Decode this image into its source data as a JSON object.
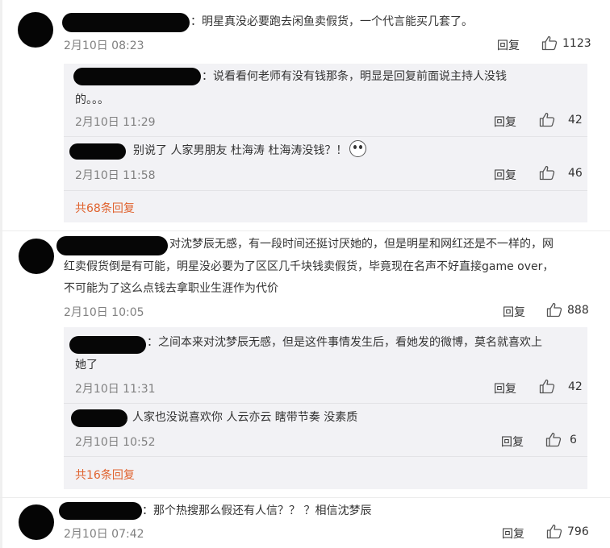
{
  "comments": [
    {
      "text": "：明星真没必要跑去闲鱼卖假货，一个代言能买几套了。",
      "time": "2月10日 08:23",
      "reply_label": "回复",
      "likes": "1123",
      "sub_replies": [
        {
          "text_line1": "：说看看何老师有没有钱那条，明显是回复前面说主持人没钱",
          "text_line2": "的。。。",
          "time": "2月10日 11:29",
          "reply_label": "回复",
          "likes": "42"
        },
        {
          "text_line1": "别说了 人家男朋友 杜海涛 杜海涛没钱？！",
          "time": "2月10日 11:58",
          "reply_label": "回复",
          "likes": "46"
        }
      ],
      "more": "共68条回复"
    },
    {
      "text_line1": "对沈梦辰无感，有一段时间还挺讨厌她的，但是明星和网红还是不一样的，网",
      "text_line2": "红卖假货倒是有可能，明星没必要为了区区几千块钱卖假货，毕竟现在名声不好直接game over，",
      "text_line3": "不可能为了这么点钱去拿职业生涯作为代价",
      "time": "2月10日 10:05",
      "reply_label": "回复",
      "likes": "888",
      "sub_replies": [
        {
          "text_line1": "：之间本来对沈梦辰无感，但是这件事情发生后，看她发的微博，莫名就喜欢上",
          "text_line2": "她了",
          "time": "2月10日 11:31",
          "reply_label": "回复",
          "likes": "42"
        },
        {
          "text_line1": ". 人家也没说喜欢你 人云亦云 瞎带节奏 没素质",
          "time": "2月10日 10:52",
          "reply_label": "回复",
          "likes": "6"
        }
      ],
      "more": "共16条回复"
    },
    {
      "text": "：那个热搜那么假还有人信？？ ？相信沈梦辰",
      "time": "2月10日 07:42",
      "reply_label": "回复",
      "likes": "796"
    }
  ],
  "icons": {
    "like": "thumbs-up-icon",
    "emoji": "surprised-face-emoji"
  },
  "colors": {
    "more_link": "#e0632f",
    "time": "#808080",
    "subbox_bg": "#f2f2f5"
  }
}
